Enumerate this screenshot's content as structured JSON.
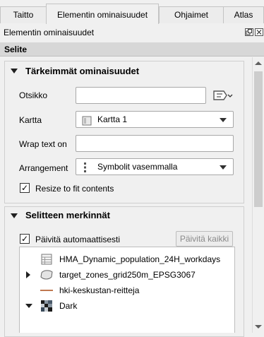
{
  "tabs": [
    {
      "label": "Taitto"
    },
    {
      "label": "Elementin ominaisuudet"
    },
    {
      "label": "Ohjaimet"
    },
    {
      "label": "Atlas"
    }
  ],
  "dock": {
    "title": "Elementin ominaisuudet"
  },
  "section": {
    "title": "Selite"
  },
  "main_props": {
    "title": "Tärkeimmät ominaisuudet",
    "title_label": "Otsikko",
    "title_value": "",
    "map_label": "Kartta",
    "map_value": "Kartta 1",
    "wrap_label": "Wrap text on",
    "wrap_value": "",
    "arrangement_label": "Arrangement",
    "arrangement_value": "Symbolit vasemmalla",
    "resize_label": "Resize to fit contents",
    "resize_checked": true
  },
  "legend_items": {
    "title": "Selitteen merkinnät",
    "auto_update_label": "Päivitä automaattisesti",
    "auto_update_checked": true,
    "update_all_label": "Päivitä kaikki",
    "items": [
      {
        "label": "HMA_Dynamic_population_24H_workdays",
        "icon": "table-layer-icon",
        "expander": "none"
      },
      {
        "label": "target_zones_grid250m_EPSG3067",
        "icon": "polygon-layer-icon",
        "expander": "collapsed"
      },
      {
        "label": "hki-keskustan-reitteja",
        "icon": "line-symbol-icon",
        "expander": "none"
      },
      {
        "label": "Dark",
        "icon": "raster-layer-icon",
        "expander": "expanded"
      }
    ]
  },
  "colors": {
    "line_symbol": "#c07850",
    "panel_bg": "#f0f0f0",
    "section_header_bg": "#d7d7d7"
  }
}
